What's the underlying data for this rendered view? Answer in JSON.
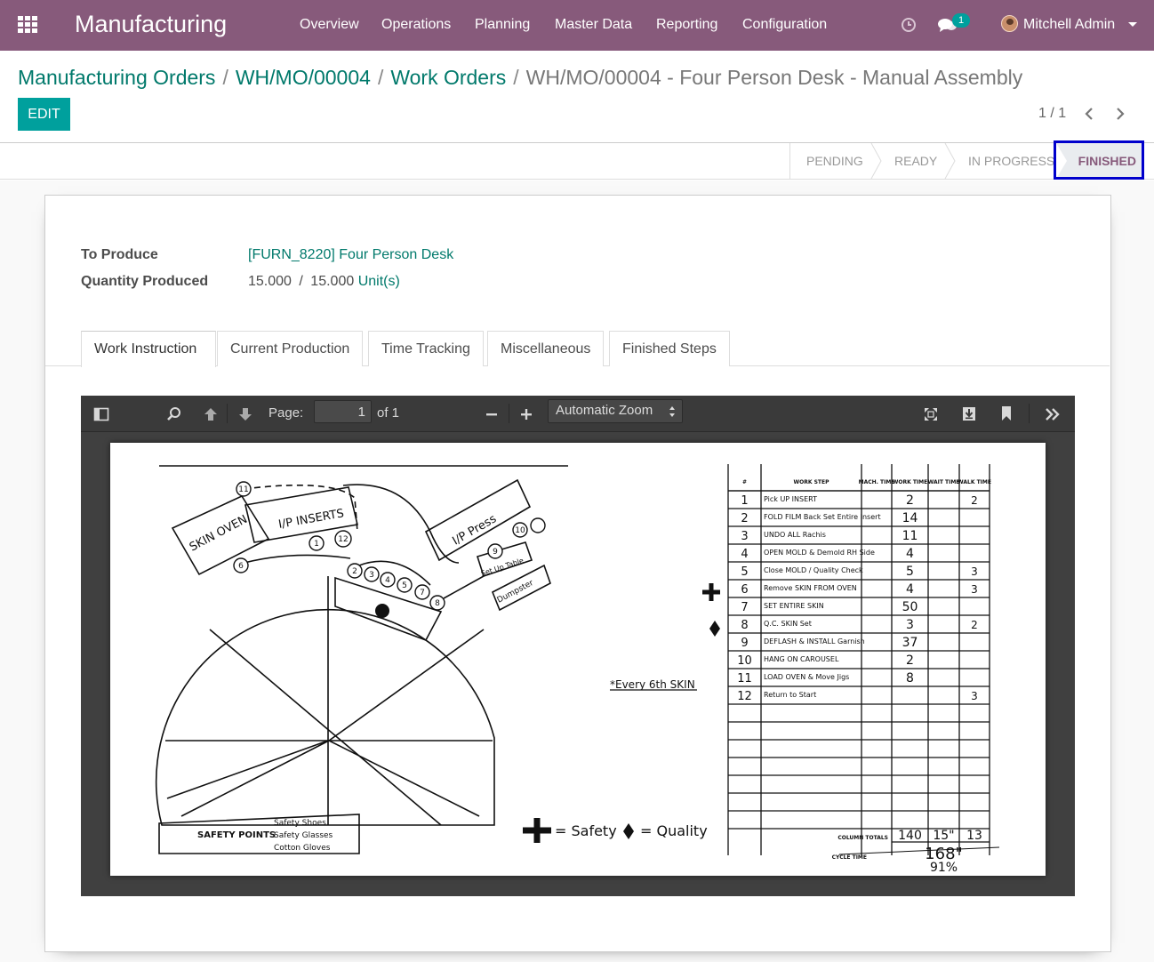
{
  "nav": {
    "brand": "Manufacturing",
    "menu": [
      "Overview",
      "Operations",
      "Planning",
      "Master Data",
      "Reporting",
      "Configuration"
    ],
    "message_count": "1",
    "user": "Mitchell Admin"
  },
  "breadcrumb": {
    "items": [
      "Manufacturing Orders",
      "WH/MO/00004",
      "Work Orders"
    ],
    "current": "WH/MO/00004 - Four Person Desk - Manual Assembly"
  },
  "actions": {
    "edit": "EDIT"
  },
  "pager": {
    "value": "1 / 1"
  },
  "status": {
    "stages": [
      "PENDING",
      "READY",
      "IN PROGRESS",
      "FINISHED"
    ],
    "current": "FINISHED"
  },
  "form": {
    "to_produce_label": "To Produce",
    "to_produce_value": "[FURN_8220] Four Person Desk",
    "qty_label": "Quantity Produced",
    "qty_done": "15.000",
    "qty_sep": "/",
    "qty_total": "15.000",
    "qty_uom": "Unit(s)"
  },
  "tabs": [
    "Work Instruction",
    "Current Production",
    "Time Tracking",
    "Miscellaneous",
    "Finished Steps"
  ],
  "pdf": {
    "page_label": "Page:",
    "page_number": "1",
    "page_total": "of 1",
    "zoom": "Automatic Zoom",
    "drawing": {
      "labels": {
        "skin_oven": "SKIN OVEN",
        "ip_inserts": "I/P INSERTS",
        "ip_press": "I/P Press",
        "set_up_table": "Set Up Table",
        "dumpster": "Dumpster",
        "every_6th": "*Every 6th SKIN",
        "safety_points": "SAFETY POINTS",
        "safety_list": [
          "Safety Shoes",
          "Safety Glasses",
          "Cotton Gloves"
        ],
        "legend_safety": "= Safety",
        "legend_quality": "= Quality"
      },
      "table_headers": [
        "#",
        "WORK STEP",
        "MACH. TIME",
        "WORK TIME",
        "WAIT TIME",
        "WALK TIME"
      ],
      "rows": [
        {
          "n": "1",
          "step": "Pick UP INSERT",
          "work": "2",
          "walk": "2"
        },
        {
          "n": "2",
          "step": "FOLD FILM Back Set Entire Insert",
          "work": "14",
          "walk": ""
        },
        {
          "n": "3",
          "step": "UNDO ALL Rachis",
          "work": "11",
          "walk": ""
        },
        {
          "n": "4",
          "step": "OPEN MOLD & Demold RH Side",
          "work": "4",
          "walk": ""
        },
        {
          "n": "5",
          "step": "Close MOLD / Quality Check",
          "work": "5",
          "walk": "3"
        },
        {
          "n": "6",
          "step": "Remove SKIN FROM OVEN",
          "work": "4",
          "walk": "3"
        },
        {
          "n": "7",
          "step": "SET ENTIRE SKIN",
          "work": "50",
          "walk": ""
        },
        {
          "n": "8",
          "step": "Q.C. SKIN Set",
          "work": "3",
          "walk": "2"
        },
        {
          "n": "9",
          "step": "DEFLASH & INSTALL Garnish",
          "work": "37",
          "walk": ""
        },
        {
          "n": "10",
          "step": "HANG ON CAROUSEL",
          "work": "2",
          "walk": ""
        },
        {
          "n": "11",
          "step": "LOAD OVEN & Move Jigs",
          "work": "8",
          "walk": ""
        },
        {
          "n": "12",
          "step": "Return to Start",
          "work": "",
          "walk": "3"
        }
      ],
      "column_totals_label": "COLUMN TOTALS",
      "totals": {
        "work": "140",
        "wait": "15\"",
        "walk": "13"
      },
      "cycle_time_label": "CYCLE TIME",
      "cycle_time": "168\"",
      "efficiency": "91%"
    }
  }
}
